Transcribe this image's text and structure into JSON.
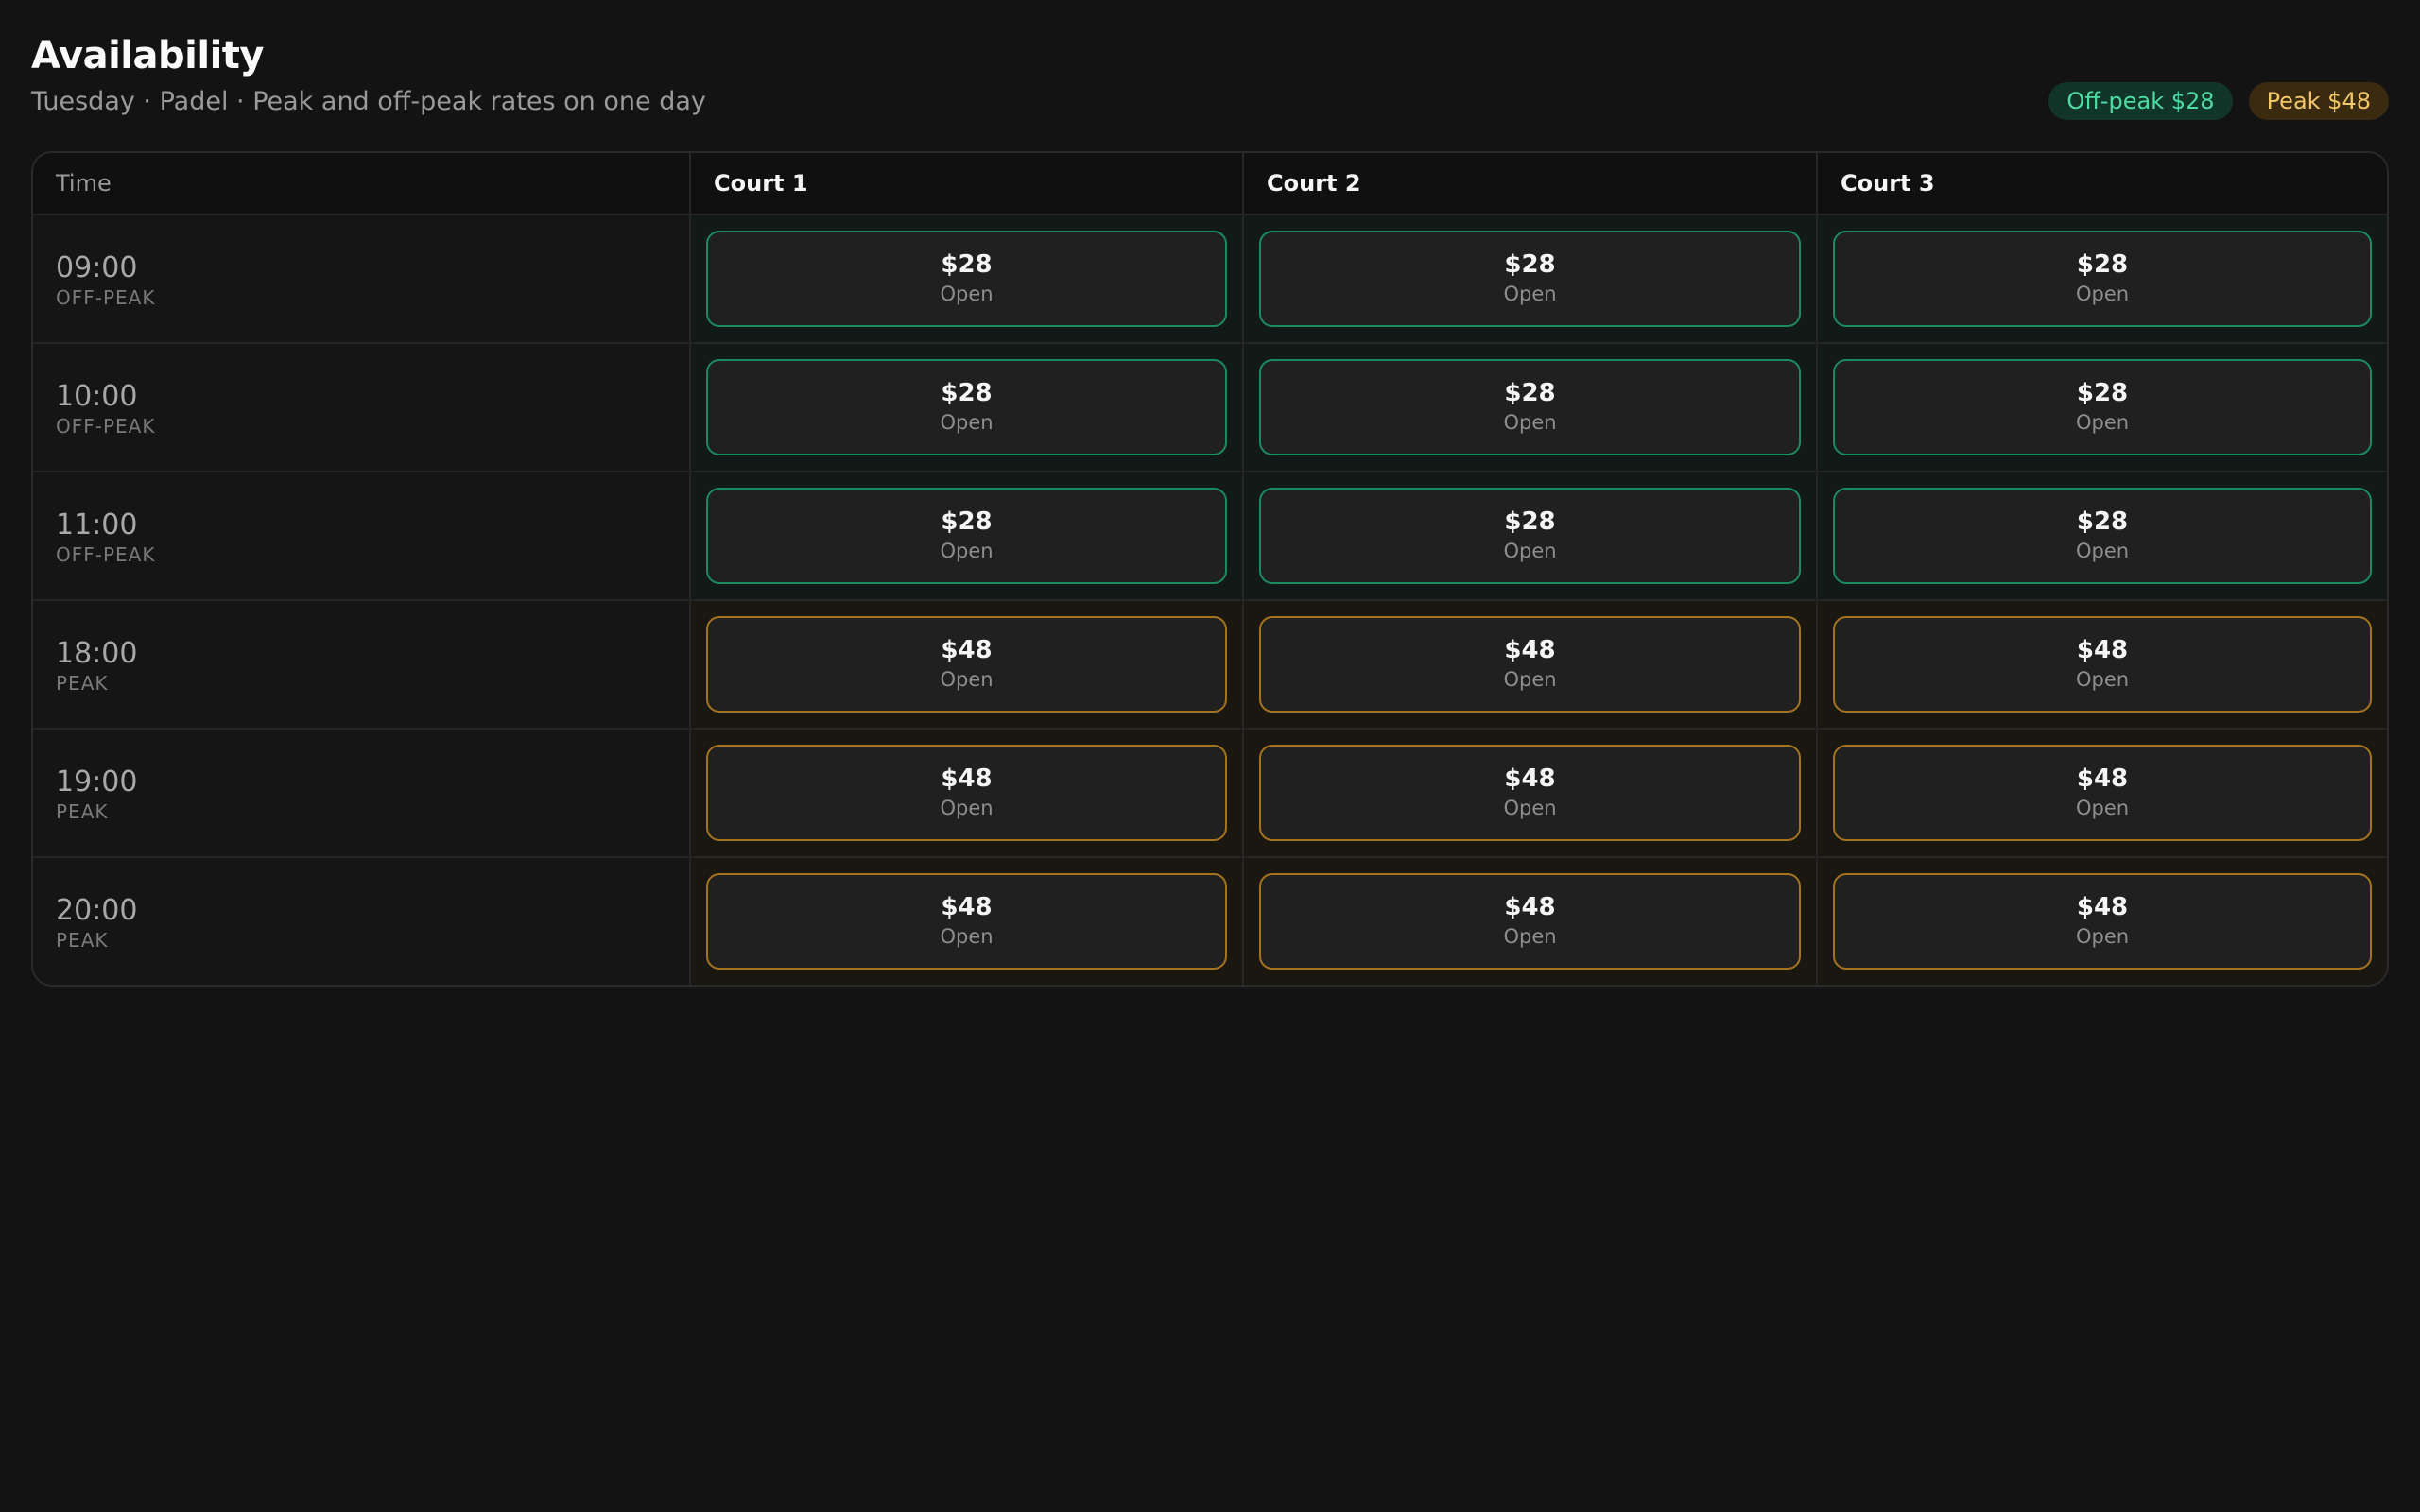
{
  "header": {
    "title": "Availability",
    "subtitle": "Tuesday · Padel · Peak and off-peak rates on one day"
  },
  "legend": {
    "offpeak_label": "Off-peak $28",
    "peak_label": "Peak $48",
    "offpeak_color": "#4fdba4",
    "peak_color": "#f3c86a"
  },
  "table": {
    "time_header": "Time",
    "courts": [
      "Court 1",
      "Court 2",
      "Court 3"
    ],
    "rows": [
      {
        "time": "09:00",
        "rate": "OFF-PEAK",
        "kind": "off",
        "slots": [
          {
            "price": "$28",
            "status": "Open"
          },
          {
            "price": "$28",
            "status": "Open"
          },
          {
            "price": "$28",
            "status": "Open"
          }
        ]
      },
      {
        "time": "10:00",
        "rate": "OFF-PEAK",
        "kind": "off",
        "slots": [
          {
            "price": "$28",
            "status": "Open"
          },
          {
            "price": "$28",
            "status": "Open"
          },
          {
            "price": "$28",
            "status": "Open"
          }
        ]
      },
      {
        "time": "11:00",
        "rate": "OFF-PEAK",
        "kind": "off",
        "slots": [
          {
            "price": "$28",
            "status": "Open"
          },
          {
            "price": "$28",
            "status": "Open"
          },
          {
            "price": "$28",
            "status": "Open"
          }
        ]
      },
      {
        "time": "18:00",
        "rate": "PEAK",
        "kind": "peak",
        "slots": [
          {
            "price": "$48",
            "status": "Open"
          },
          {
            "price": "$48",
            "status": "Open"
          },
          {
            "price": "$48",
            "status": "Open"
          }
        ]
      },
      {
        "time": "19:00",
        "rate": "PEAK",
        "kind": "peak",
        "slots": [
          {
            "price": "$48",
            "status": "Open"
          },
          {
            "price": "$48",
            "status": "Open"
          },
          {
            "price": "$48",
            "status": "Open"
          }
        ]
      },
      {
        "time": "20:00",
        "rate": "PEAK",
        "kind": "peak",
        "slots": [
          {
            "price": "$48",
            "status": "Open"
          },
          {
            "price": "$48",
            "status": "Open"
          },
          {
            "price": "$48",
            "status": "Open"
          }
        ]
      }
    ]
  }
}
